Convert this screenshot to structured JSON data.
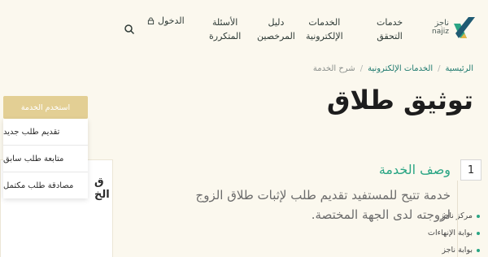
{
  "header": {
    "logo_text_line1": "ناجز",
    "logo_text_line2": "najiz",
    "nav": {
      "verification_line1": "خدمات",
      "verification_line2": "التحقق",
      "eservices_line1": "الخدمات",
      "eservices_line2": "الإلكترونية",
      "licensed_line1": "دليل",
      "licensed_line2": "المرخصين",
      "faq_line1": "الأسئلة",
      "faq_line2": "المتكررة"
    },
    "login_label": "الدخول"
  },
  "breadcrumb": {
    "home": "الرئيسية",
    "sep": "/",
    "eservices": "الخدمات الإلكترونية",
    "current": "شرح الخدمة"
  },
  "page_title": "توثيق طلاق",
  "use_service": {
    "button_label": "استخدم الخدمة",
    "items": [
      "تقديم طلب جديد",
      "متابعة طلب سابق",
      "مصادقة طلب مكتمل"
    ]
  },
  "side_card": {
    "title_line1": "ق",
    "title_line2": "الخ",
    "links": [
      "مركز ناجز",
      "بوابة الإنهاءات",
      "بوابة ناجز"
    ]
  },
  "section": {
    "number": "1",
    "title": "وصف الخدمة",
    "description": "خدمة تتيح للمستفيد تقديم طلب لإثبات طلاق الزوج لزوجته لدى الجهة المختصة."
  },
  "colors": {
    "accent": "#2aa584",
    "button": "#e3cf94",
    "background": "#fbf8ee"
  }
}
